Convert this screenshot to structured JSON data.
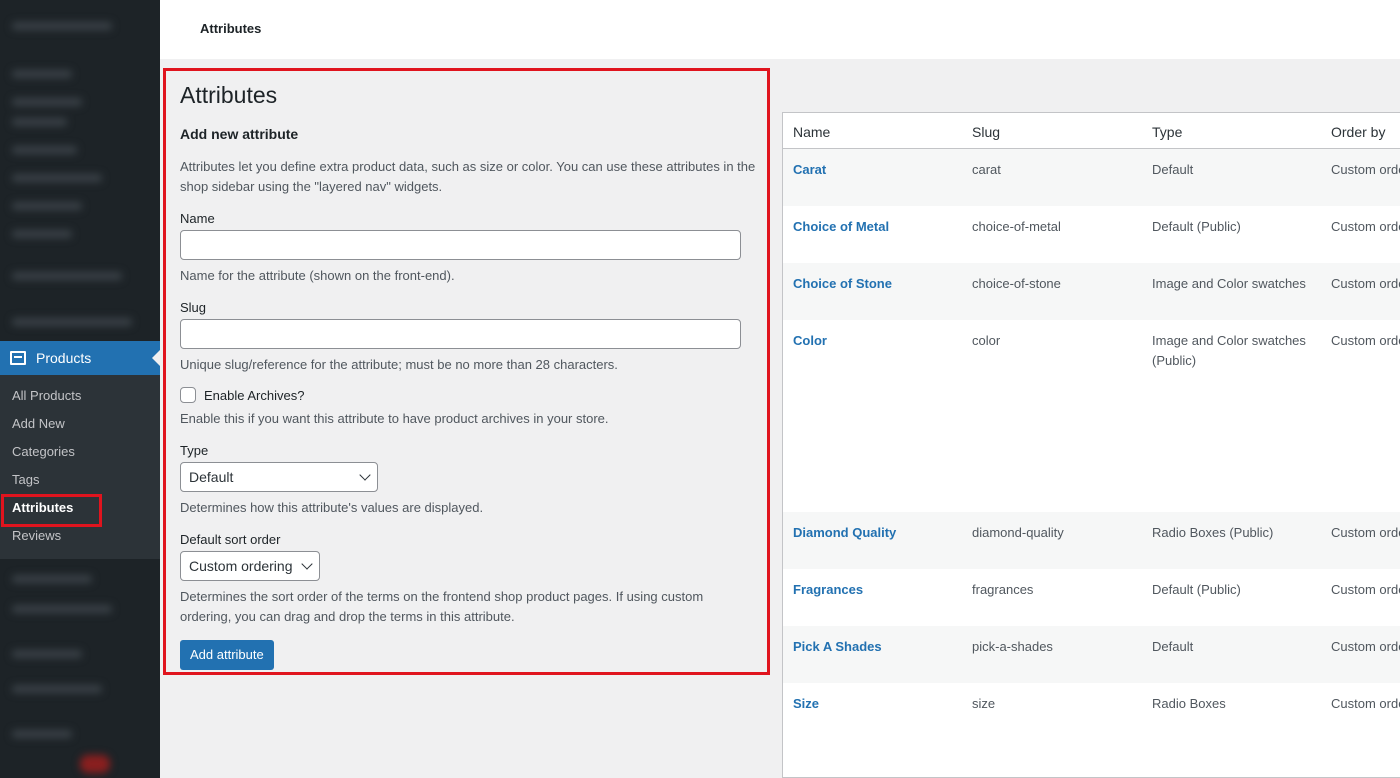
{
  "sidebar": {
    "active_menu": "Products",
    "submenu": [
      "All Products",
      "Add New",
      "Categories",
      "Tags",
      "Attributes",
      "Reviews"
    ],
    "current_submenu_index": 4
  },
  "topbar": {
    "breadcrumb": "Attributes"
  },
  "form": {
    "page_title": "Attributes",
    "section_title": "Add new attribute",
    "intro": "Attributes let you define extra product data, such as size or color. You can use these attributes in the shop sidebar using the \"layered nav\" widgets.",
    "name_label": "Name",
    "name_value": "",
    "name_help": "Name for the attribute (shown on the front-end).",
    "slug_label": "Slug",
    "slug_value": "",
    "slug_help": "Unique slug/reference for the attribute; must be no more than 28 characters.",
    "archives_label": "Enable Archives?",
    "archives_checked": false,
    "archives_help": "Enable this if you want this attribute to have product archives in your store.",
    "type_label": "Type",
    "type_value": "Default",
    "type_help": "Determines how this attribute's values are displayed.",
    "sort_label": "Default sort order",
    "sort_value": "Custom ordering",
    "sort_help": "Determines the sort order of the terms on the frontend shop product pages. If using custom ordering, you can drag and drop the terms in this attribute.",
    "submit_label": "Add attribute"
  },
  "table": {
    "columns": [
      "Name",
      "Slug",
      "Type",
      "Order by"
    ],
    "rows": [
      {
        "name": "Carat",
        "slug": "carat",
        "type": "Default",
        "order": "Custom orde"
      },
      {
        "name": "Choice of Metal",
        "slug": "choice-of-metal",
        "type": "Default (Public)",
        "order": "Custom orde"
      },
      {
        "name": "Choice of Stone",
        "slug": "choice-of-stone",
        "type": "Image and Color swatches",
        "order": "Custom orde"
      },
      {
        "name": "Color",
        "slug": "color",
        "type": "Image and Color swatches (Public)",
        "order": "Custom orde"
      },
      {
        "name": "Diamond Quality",
        "slug": "diamond-quality",
        "type": "Radio Boxes (Public)",
        "order": "Custom orde"
      },
      {
        "name": "Fragrances",
        "slug": "fragrances",
        "type": "Default (Public)",
        "order": "Custom orde"
      },
      {
        "name": "Pick A Shades",
        "slug": "pick-a-shades",
        "type": "Default",
        "order": "Custom orde"
      },
      {
        "name": "Size",
        "slug": "size",
        "type": "Radio Boxes",
        "order": "Custom orde"
      }
    ]
  },
  "colors": {
    "accent": "#2271b1",
    "highlight": "#e0141e",
    "sidebar": "#1d2327"
  }
}
